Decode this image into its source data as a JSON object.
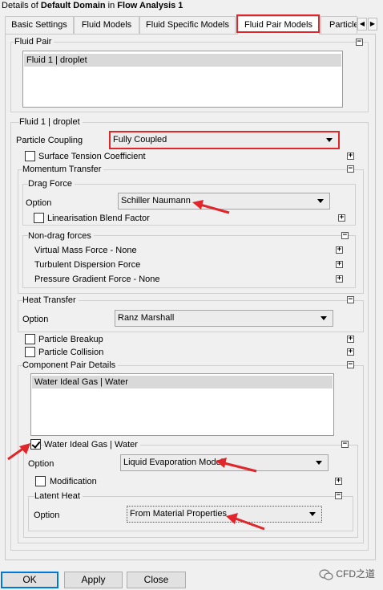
{
  "window": {
    "title_prefix": "Details of ",
    "title_domain": "Default Domain",
    "title_mid": " in ",
    "title_analysis": "Flow Analysis 1"
  },
  "tabs": [
    {
      "label": "Basic Settings"
    },
    {
      "label": "Fluid Models"
    },
    {
      "label": "Fluid Specific Models"
    },
    {
      "label": "Fluid Pair Models",
      "active": true
    },
    {
      "label": "Particle"
    }
  ],
  "fluid_pair": {
    "title": "Fluid Pair",
    "items": [
      "Fluid 1 | droplet"
    ]
  },
  "pair_section": {
    "title": "Fluid 1 | droplet",
    "particle_coupling_label": "Particle Coupling",
    "particle_coupling_value": "Fully Coupled",
    "surface_tension_label": "Surface Tension Coefficient"
  },
  "momentum": {
    "title": "Momentum Transfer",
    "drag_title": "Drag Force",
    "option_label": "Option",
    "option_value": "Schiller Naumann",
    "linearisation_label": "Linearisation Blend Factor",
    "nondrag_title": "Non-drag forces",
    "virtual_mass": "Virtual Mass Force - None",
    "turbulent_dispersion": "Turbulent Dispersion Force",
    "pressure_gradient": "Pressure Gradient Force - None"
  },
  "heat": {
    "title": "Heat Transfer",
    "option_label": "Option",
    "option_value": "Ranz Marshall"
  },
  "breakup_label": "Particle Breakup",
  "collision_label": "Particle Collision",
  "component": {
    "title": "Component Pair Details",
    "items": [
      "Water Ideal Gas | Water"
    ],
    "checked_label": "Water Ideal Gas | Water",
    "option_label": "Option",
    "option_value": "Liquid Evaporation Model",
    "modification_label": "Modification",
    "latent_title": "Latent Heat",
    "latent_option_label": "Option",
    "latent_option_value": "From Material Properties"
  },
  "buttons": {
    "ok": "OK",
    "apply": "Apply",
    "close": "Close"
  },
  "watermark": "CFD之道",
  "colors": {
    "highlight": "#e0252b",
    "arrow": "#e0252b"
  }
}
